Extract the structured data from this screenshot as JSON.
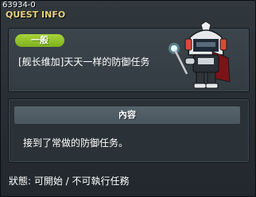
{
  "window": {
    "code": "63934-0",
    "title": "QUEST INFO"
  },
  "quest": {
    "category": "一般",
    "name": "[舰长维加]天天一样的防御任务",
    "npc_icon": "armored-robot-npc-icon"
  },
  "content": {
    "header": "內容",
    "text": "接到了常做的防御任务。"
  },
  "footer": {
    "status": "狀態:  可開始  / 不可執行任務"
  },
  "colors": {
    "title": "#e8d27a",
    "badge": "#8cc126",
    "background": "#262d32"
  }
}
